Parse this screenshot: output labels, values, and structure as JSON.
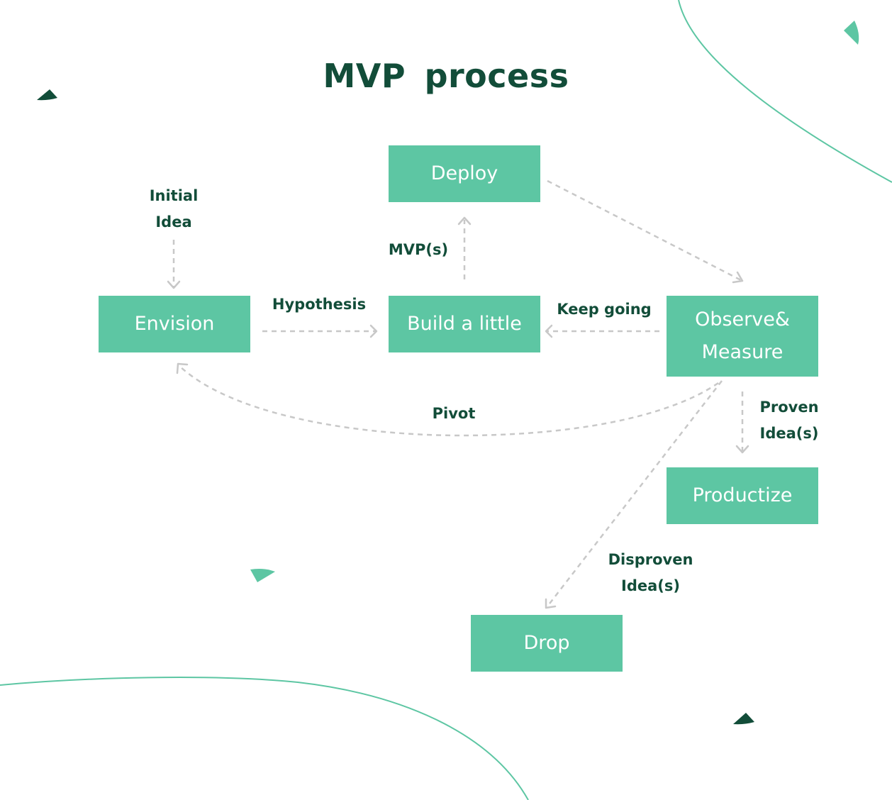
{
  "title": "MVP process",
  "colors": {
    "node_fill": "#5dc6a3",
    "node_text": "#ffffff",
    "label_text": "#124d39",
    "arrow": "#c8c8c8",
    "decor_dark": "#124d39",
    "decor_light": "#5dc6a3"
  },
  "nodes": {
    "deploy": "Deploy",
    "envision": "Envision",
    "build": "Build a little",
    "observe_line1": "Observe&",
    "observe_line2": "Measure",
    "productize": "Productize",
    "drop": "Drop"
  },
  "edge_labels": {
    "initial_line1": "Initial",
    "initial_line2": "Idea",
    "hypothesis": "Hypothesis",
    "mvps": "MVP(s)",
    "keep_going": "Keep going",
    "pivot": "Pivot",
    "proven_line1": "Proven",
    "proven_line2": "Idea(s)",
    "disproven_line1": "Disproven",
    "disproven_line2": "Idea(s)"
  },
  "edges": [
    {
      "from": "initial-idea",
      "to": "envision",
      "label": "Initial Idea"
    },
    {
      "from": "envision",
      "to": "build",
      "label": "Hypothesis"
    },
    {
      "from": "build",
      "to": "deploy",
      "label": "MVP(s)"
    },
    {
      "from": "deploy",
      "to": "observe",
      "label": ""
    },
    {
      "from": "observe",
      "to": "build",
      "label": "Keep going"
    },
    {
      "from": "observe",
      "to": "envision",
      "label": "Pivot"
    },
    {
      "from": "observe",
      "to": "productize",
      "label": "Proven Idea(s)"
    },
    {
      "from": "observe",
      "to": "drop",
      "label": "Disproven Idea(s)"
    }
  ]
}
